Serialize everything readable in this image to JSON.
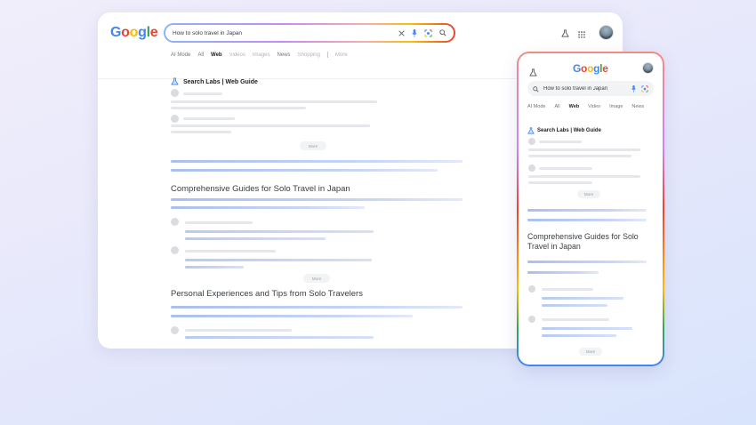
{
  "desktop": {
    "logo": [
      "G",
      "o",
      "o",
      "g",
      "l",
      "e"
    ],
    "search": {
      "query": "How to solo travel in Japan"
    },
    "tabs": [
      {
        "label": "AI Mode",
        "active": false
      },
      {
        "label": "All",
        "active": false
      },
      {
        "label": "Web",
        "active": true
      },
      {
        "label": "Videos",
        "active": false
      },
      {
        "label": "Images",
        "active": false
      },
      {
        "label": "News",
        "active": false
      },
      {
        "label": "Shopping",
        "active": false
      },
      {
        "label": "More",
        "active": false
      }
    ],
    "labs_label": "Search Labs | Web Guide",
    "more_label": "More",
    "sections": [
      {
        "title": "Comprehensive Guides for Solo Travel in Japan"
      },
      {
        "title": "Personal Experiences and Tips from Solo Travelers"
      }
    ]
  },
  "mobile": {
    "logo": [
      "G",
      "o",
      "o",
      "g",
      "l",
      "e"
    ],
    "search": {
      "query": "How to solo travel in Japan"
    },
    "tabs": [
      {
        "label": "AI Mode",
        "active": false
      },
      {
        "label": "All",
        "active": false
      },
      {
        "label": "Web",
        "active": true
      },
      {
        "label": "Video",
        "active": false
      },
      {
        "label": "Image",
        "active": false
      },
      {
        "label": "News",
        "active": false
      }
    ],
    "labs_label": "Search Labs | Web Guide",
    "more_label": "More",
    "sections": [
      {
        "title": "Comprehensive Guides for Solo Travel in Japan"
      }
    ]
  },
  "icons": {
    "close": "close-icon",
    "mic": "mic-icon",
    "lens": "lens-icon",
    "search": "search-icon",
    "labs": "flask-icon",
    "apps": "apps-grid-icon"
  },
  "colors": {
    "google_blue": "#4285f4",
    "google_red": "#ea4335",
    "google_yellow": "#fbbc05",
    "google_green": "#34a853",
    "placeholder_bar": "#e6e7ea",
    "highlight_bar": "#a9c0ee"
  }
}
